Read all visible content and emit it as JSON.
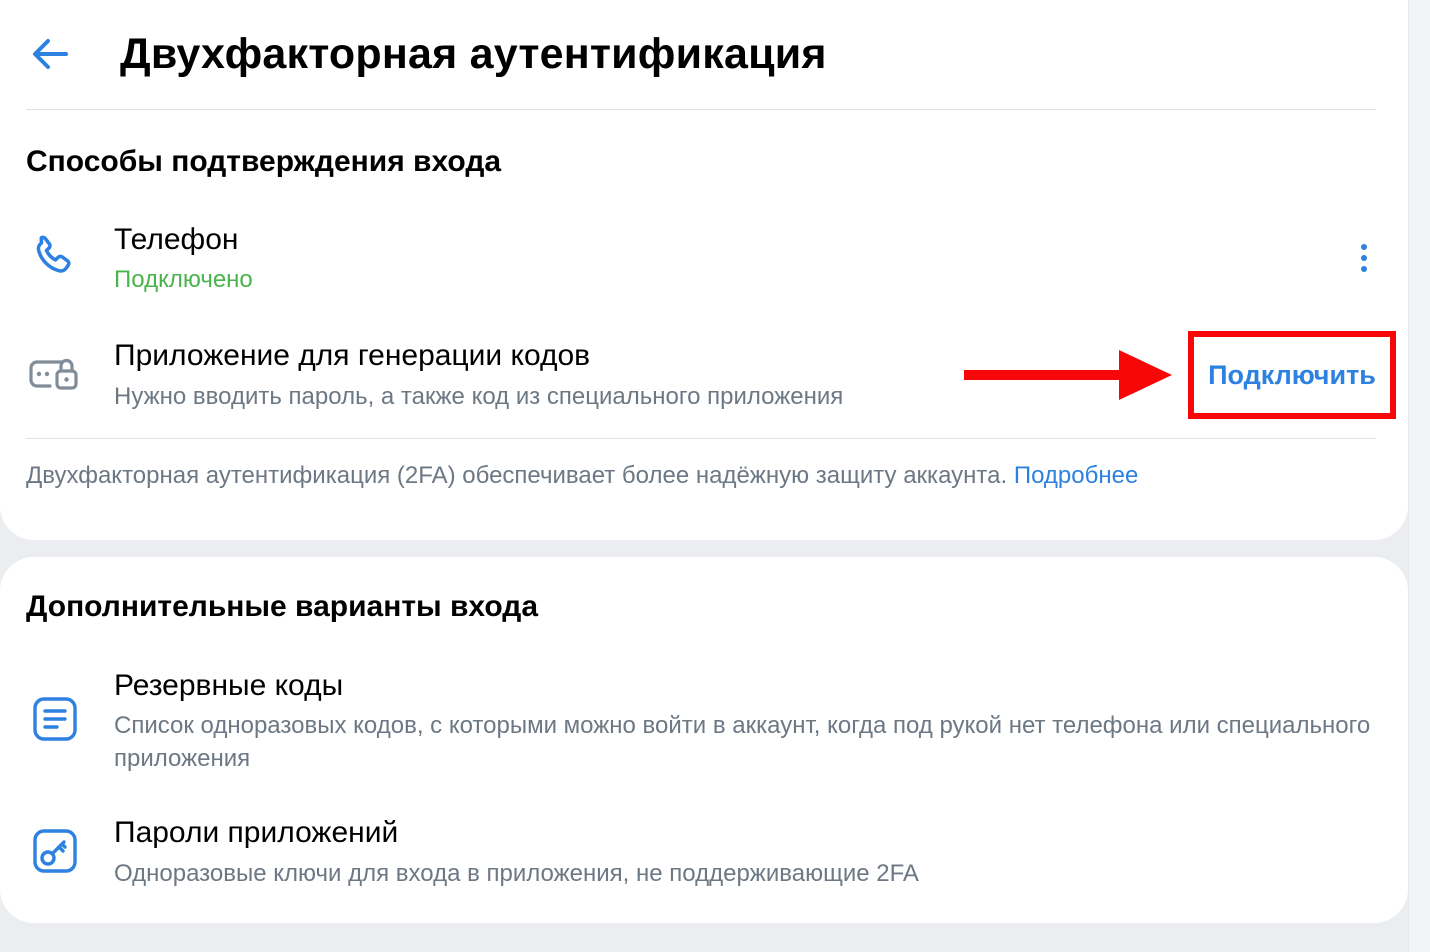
{
  "header": {
    "title": "Двухфакторная аутентификация",
    "back_icon": "arrow-left-icon"
  },
  "confirm_section": {
    "title": "Способы подтверждения входа",
    "items": [
      {
        "icon": "phone-icon",
        "title": "Телефон",
        "subtitle": "Подключено",
        "action_icon": "more-vertical-icon"
      },
      {
        "icon": "code-generator-lock-icon",
        "title": "Приложение для генерации кодов",
        "subtitle": "Нужно вводить пароль, а также код из специального приложения",
        "action_label": "Подключить"
      }
    ],
    "info_text": "Двухфакторная аутентификация (2FA) обеспечивает более надёжную защиту аккаунта.",
    "info_link": "Подробнее"
  },
  "extra_section": {
    "title": "Дополнительные варианты входа",
    "items": [
      {
        "icon": "document-list-icon",
        "title": "Резервные коды",
        "subtitle": "Список одноразовых кодов, с которыми можно войти в аккаунт, когда под рукой нет телефона или специального приложения"
      },
      {
        "icon": "key-icon",
        "title": "Пароли приложений",
        "subtitle": "Одноразовые ключи для входа в приложения, не поддерживающие 2FA"
      }
    ]
  },
  "colors": {
    "accent": "#2d81e0",
    "success": "#4bb34b",
    "secondary_text": "#6d7885",
    "highlight": "#f70707"
  }
}
